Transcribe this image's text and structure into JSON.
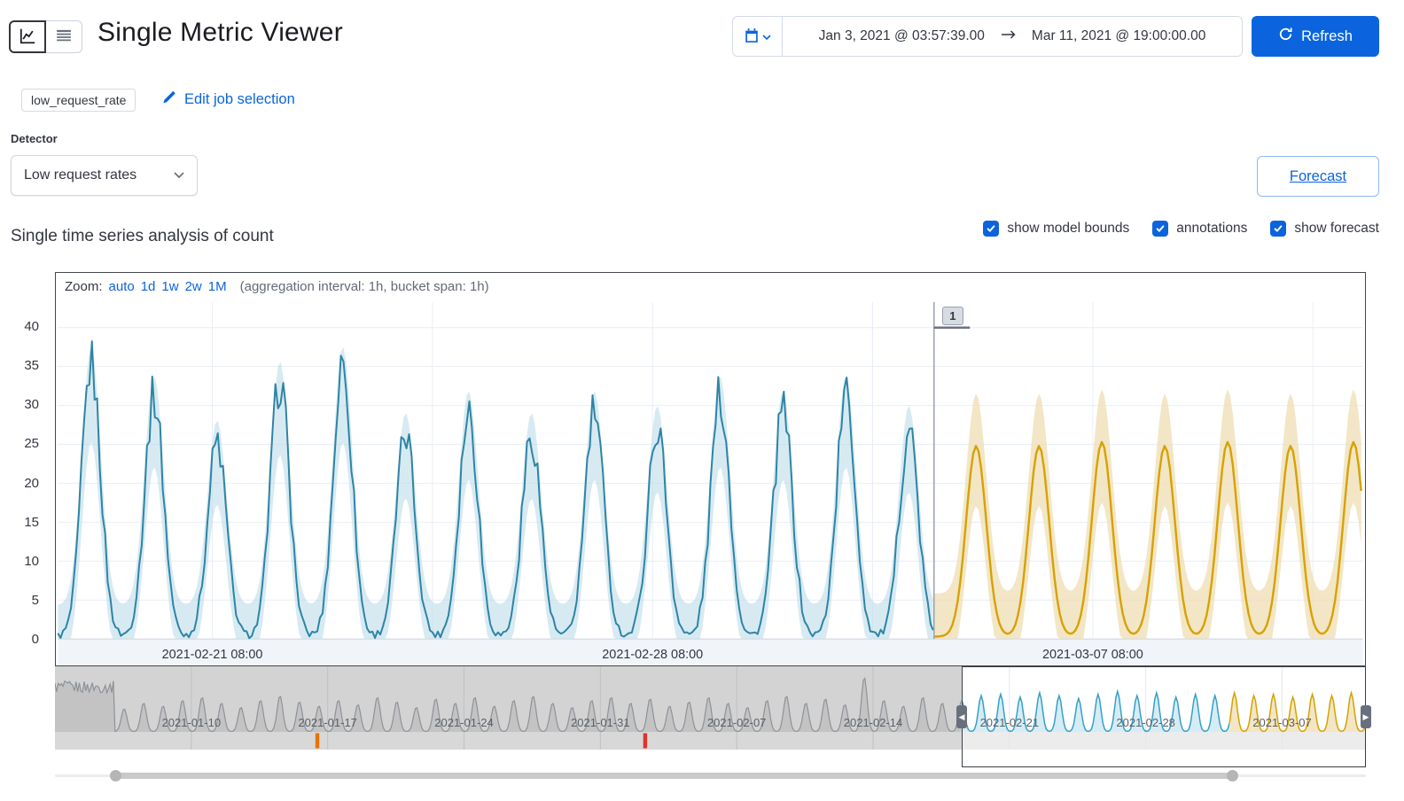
{
  "colors": {
    "primary": "#0b64dd",
    "text": "#343741",
    "subtle_text": "#646a77",
    "border": "#d3dae6",
    "chart_border": "#43474e",
    "grid": "#e9eef5",
    "axis_line": "#cbd3df",
    "strip_bg": "#f1f5fa",
    "observed_line": "#2e84a5",
    "bounds_fill": "#bcdcea",
    "forecast_line": "#d6a200",
    "forecast_fill": "#eedcae",
    "divider": "#9aa2ad",
    "nav_bg": "#d3d3d3",
    "nav_line": "#8d9298",
    "nav_gray_fill": "rgba(110,115,120,0.16)",
    "nav_blue_line": "#35a0c8",
    "nav_blue_fill": "#cfe9f3",
    "nav_yellow_line": "#d6a200",
    "nav_yellow_fill": "#f0e2ba",
    "swimlane_bg": "#d8d8d8",
    "swimlane_sel_bg": "#ececec",
    "annotation_orange": "#e8710a",
    "annotation_red": "#e0332e"
  },
  "icons": {
    "selection_left_handle": "◀",
    "selection_right_handle": "▶"
  },
  "header": {
    "title": "Single Metric Viewer",
    "refresh": "Refresh",
    "start_date": "Jan 3, 2021 @ 03:57:39.00",
    "end_date": "Mar 11, 2021 @ 19:00:00.00"
  },
  "job": {
    "badge": "low_request_rate",
    "edit_link": "Edit job selection"
  },
  "detector": {
    "label": "Detector",
    "selected": "Low request rates"
  },
  "forecast_button": "Forecast",
  "analysis": {
    "heading": "Single time series analysis of count",
    "toggles": [
      {
        "label": "show model bounds",
        "checked": true
      },
      {
        "label": "annotations",
        "checked": true
      },
      {
        "label": "show forecast",
        "checked": true
      }
    ]
  },
  "zoom": {
    "label": "Zoom:",
    "options": [
      "auto",
      "1d",
      "1w",
      "2w",
      "1M"
    ],
    "suffix": "(aggregation interval: 1h, bucket span: 1h)"
  },
  "chart_data": {
    "type": "line",
    "ylabel": "count",
    "y_ticks": [
      0,
      5,
      10,
      15,
      20,
      25,
      30,
      35,
      40
    ],
    "ylim": [
      0,
      43
    ],
    "domain_days": 20.75,
    "x_ticks": [
      {
        "label": "2021-02-21 08:00",
        "day": 2.455
      },
      {
        "label": "2021-02-28 08:00",
        "day": 9.455
      },
      {
        "label": "2021-03-07 08:00",
        "day": 16.455
      }
    ],
    "x_grid_days": [
      2.455,
      5.955,
      9.455,
      12.955,
      16.455,
      19.955
    ],
    "forecast_start_day": 13.93,
    "observed_peaks": {
      "day_centers": [
        0.53,
        1.53,
        2.53,
        3.53,
        4.53,
        5.53,
        6.53,
        7.53,
        8.53,
        9.53,
        10.53,
        11.53,
        12.53,
        13.53
      ],
      "heights": [
        35,
        31,
        25,
        33,
        35,
        26,
        29,
        26,
        29,
        27,
        31,
        29,
        31,
        27
      ]
    },
    "forecast_peaks": {
      "day_centers": [
        14.6,
        15.6,
        16.6,
        17.6,
        18.6,
        19.6,
        20.6
      ],
      "heights": [
        24.5,
        24.5,
        25,
        24.5,
        25,
        24.5,
        25
      ]
    },
    "annotation": {
      "label": "1",
      "start_day": 13.93,
      "end_day": 14.5
    }
  },
  "navigator": {
    "domain_days": 67.3,
    "selection": {
      "start_day": 46.55,
      "end_day": 67.3
    },
    "forecast_start_day": 60.3,
    "blob_end_day": 3.05,
    "x_ticks": [
      {
        "label": "2021-01-10",
        "day": 7
      },
      {
        "label": "2021-01-17",
        "day": 14
      },
      {
        "label": "2021-01-24",
        "day": 21
      },
      {
        "label": "2021-01-31",
        "day": 28
      },
      {
        "label": "2021-02-07",
        "day": 35
      },
      {
        "label": "2021-02-14",
        "day": 42
      },
      {
        "label": "2021-02-21",
        "day": 49
      },
      {
        "label": "2021-02-28",
        "day": 56
      },
      {
        "label": "2021-03-07",
        "day": 63
      }
    ],
    "week_grid_days": [
      7,
      14,
      21,
      28,
      35,
      42,
      49,
      56,
      63
    ],
    "annotations": [
      {
        "day": 13.47,
        "color_key": "annotation_orange"
      },
      {
        "day": 30.3,
        "color_key": "annotation_red"
      }
    ],
    "day_peak_heights": [
      30,
      30,
      30,
      16,
      20,
      18,
      22,
      24,
      20,
      17,
      22,
      25,
      21,
      18,
      22,
      19,
      24,
      21,
      17,
      23,
      20,
      24,
      18,
      22,
      25,
      20,
      17,
      22,
      24,
      20,
      23,
      18,
      21,
      24,
      20,
      17,
      22,
      25,
      20,
      23,
      19,
      38,
      22,
      18,
      24,
      20,
      22,
      25,
      26,
      24,
      27,
      25,
      23,
      26,
      28,
      25,
      27,
      24,
      26,
      25,
      27,
      25,
      26,
      24,
      26,
      25,
      27,
      26
    ]
  },
  "scrollbar": {
    "thumb_start_frac": 0.046,
    "thumb_end_frac": 0.898
  }
}
